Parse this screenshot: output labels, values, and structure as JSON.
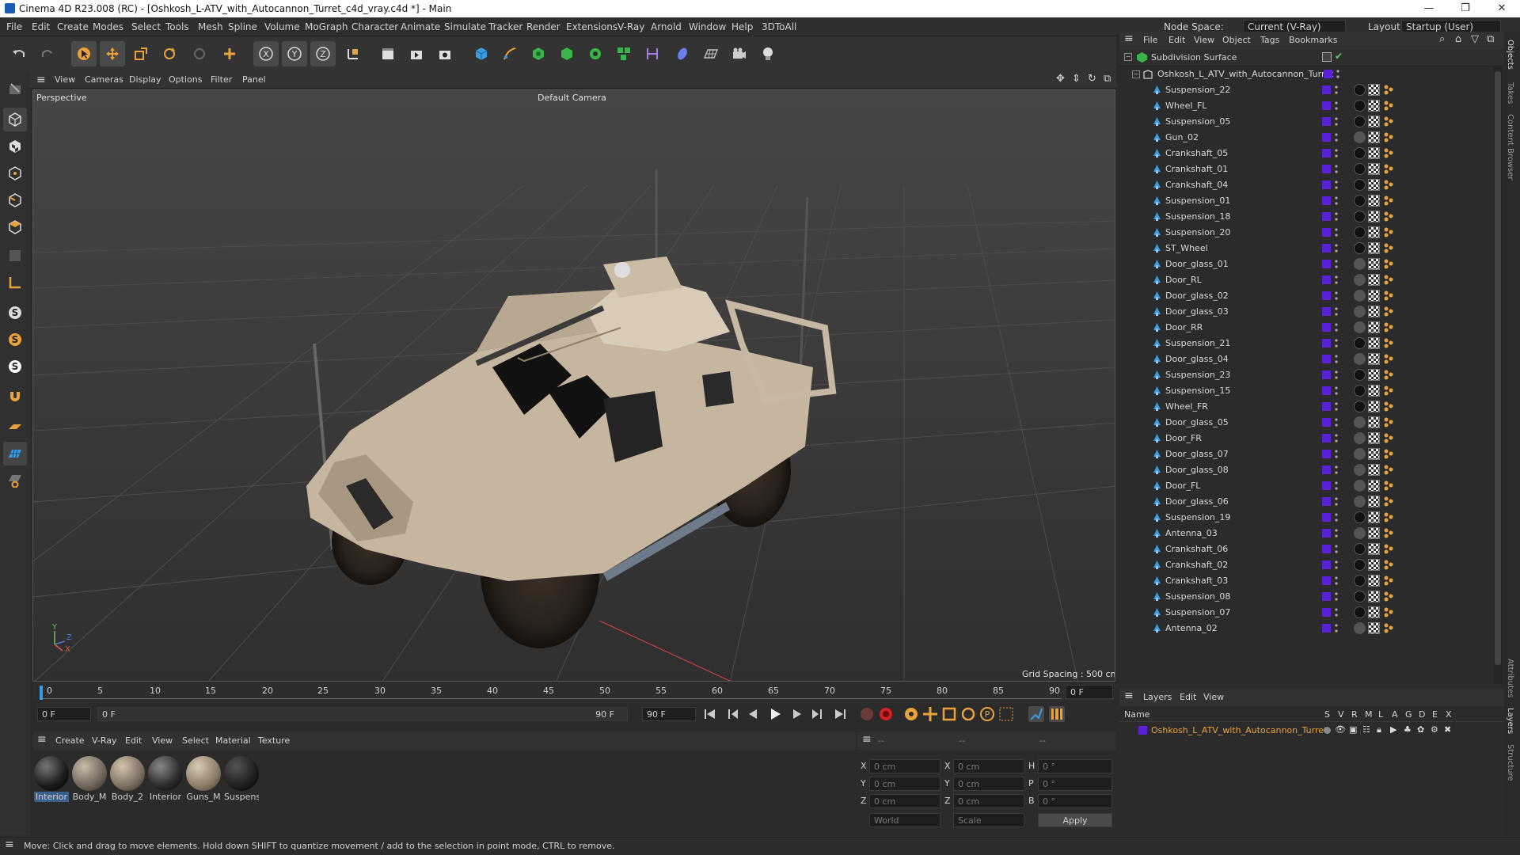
{
  "window": {
    "title": "Cinema 4D R23.008 (RC) - [Oshkosh_L-ATV_with_Autocannon_Turret_c4d_vray.c4d *] - Main"
  },
  "menu": [
    "File",
    "Edit",
    "Create",
    "Modes",
    "Select",
    "Tools",
    "Mesh",
    "Spline",
    "Volume",
    "MoGraph",
    "Character",
    "Animate",
    "Simulate",
    "Tracker",
    "Render",
    "Extensions",
    "V-Ray",
    "Arnold",
    "Window",
    "Help",
    "3DToAll"
  ],
  "node_space": {
    "label": "Node Space:",
    "value": "Current (V-Ray)"
  },
  "layout": {
    "label": "Layout:",
    "value": "Startup (User)"
  },
  "viewport": {
    "menu": [
      "View",
      "Cameras",
      "Display",
      "Options",
      "Filter",
      "Panel"
    ],
    "view_name": "Perspective",
    "camera": "Default Camera",
    "grid_spacing": "Grid Spacing : 500 cm",
    "axis_labels": [
      "Y",
      "Z",
      "X"
    ]
  },
  "timeline": {
    "ticks": [
      "0",
      "5",
      "10",
      "15",
      "20",
      "25",
      "30",
      "35",
      "40",
      "45",
      "50",
      "55",
      "60",
      "65",
      "70",
      "75",
      "80",
      "85",
      "90"
    ],
    "current_frame": "0 F",
    "start_field": "0 F",
    "range_start": "0 F",
    "range_end": "90 F",
    "end_field": "90 F"
  },
  "materials": {
    "menu": [
      "Create",
      "V-Ray",
      "Edit",
      "View",
      "Select",
      "Material",
      "Texture"
    ],
    "items": [
      {
        "label": "Interior",
        "color": "#1a1a1a"
      },
      {
        "label": "Body_M",
        "color": "#6e665c"
      },
      {
        "label": "Body_2",
        "color": "#7a6f60"
      },
      {
        "label": "Interior",
        "color": "#2a2a2a"
      },
      {
        "label": "Guns_M",
        "color": "#8a7c68"
      },
      {
        "label": "Suspens",
        "color": "#1e1e1e"
      }
    ]
  },
  "coords": {
    "header": [
      "--",
      "--",
      "--"
    ],
    "rows": [
      {
        "a": "X",
        "av": "0 cm",
        "b": "X",
        "bv": "0 cm",
        "c": "H",
        "cv": "0 °"
      },
      {
        "a": "Y",
        "av": "0 cm",
        "b": "Y",
        "bv": "0 cm",
        "c": "P",
        "cv": "0 °"
      },
      {
        "a": "Z",
        "av": "0 cm",
        "b": "Z",
        "bv": "0 cm",
        "c": "B",
        "cv": "0 °"
      }
    ],
    "world": "World",
    "scale": "Scale",
    "apply": "Apply"
  },
  "objects": {
    "menu": [
      "File",
      "Edit",
      "View",
      "Object",
      "Tags",
      "Bookmarks"
    ],
    "root": "Subdivision Surface",
    "group": "Oshkosh_L_ATV_with_Autocannon_Turret",
    "items": [
      "Suspension_22",
      "Wheel_FL",
      "Suspension_05",
      "Gun_02",
      "Crankshaft_05",
      "Crankshaft_01",
      "Crankshaft_04",
      "Suspension_01",
      "Suspension_18",
      "Suspension_20",
      "ST_Wheel",
      "Door_glass_01",
      "Door_RL",
      "Door_glass_02",
      "Door_glass_03",
      "Door_RR",
      "Suspension_21",
      "Door_glass_04",
      "Suspension_23",
      "Suspension_15",
      "Wheel_FR",
      "Door_glass_05",
      "Door_FR",
      "Door_glass_07",
      "Door_glass_08",
      "Door_FL",
      "Door_glass_06",
      "Suspension_19",
      "Antenna_03",
      "Crankshaft_06",
      "Crankshaft_02",
      "Crankshaft_03",
      "Suspension_08",
      "Suspension_07",
      "Antenna_02"
    ]
  },
  "layers": {
    "menu": [
      "Layers",
      "Edit",
      "View"
    ],
    "columns": [
      "Name",
      "S",
      "V",
      "R",
      "M",
      "L",
      "A",
      "G",
      "D",
      "E",
      "X"
    ],
    "row": "Oshkosh_L_ATV_with_Autocannon_Turret"
  },
  "side_tabs": [
    "Objects",
    "Takes",
    "Content Browser",
    "Attributes",
    "Layers",
    "Structure"
  ],
  "status": "Move: Click and drag to move elements. Hold down SHIFT to quantize movement / add to the selection in point mode, CTRL to remove."
}
